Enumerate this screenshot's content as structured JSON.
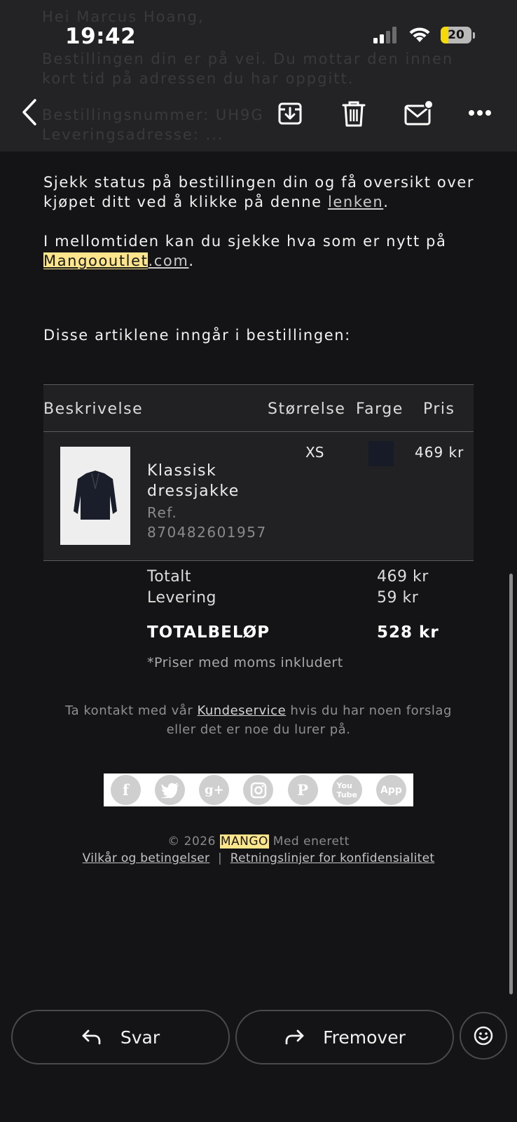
{
  "status_bar": {
    "time": "19:42",
    "battery": "20"
  },
  "ghost_text": [
    "Hei Marcus Hoang,",
    "Bestillingen din er på vei. Du mottar den innen",
    "kort tid på adressen du har oppgitt.",
    "Bestillingsnummer: UH9G",
    "Leveringsadresse: ..."
  ],
  "email": {
    "para1_text": "Sjekk status på bestillingen din og få oversikt over kjøpet ditt ved å klikke på denne ",
    "para1_link": "lenken",
    "para1_end": ".",
    "para2_text": "I mellomtiden kan du sjekke hva som er nytt på ",
    "para2_link_highlight": "Mangooutlet",
    "para2_link_rest": ".com",
    "para2_end": ".",
    "items_intro": "Disse artiklene inngår i bestillingen:",
    "table": {
      "headers": [
        "Beskrivelse",
        "Størrelse",
        "Farge",
        "Pris"
      ],
      "item": {
        "name": "Klassisk dressjakke",
        "ref": "Ref. 870482601957",
        "size": "XS",
        "color": "#161b27",
        "price": "469 kr"
      }
    },
    "summary": {
      "total_label": "Totalt",
      "total_value": "469 kr",
      "delivery_label": "Levering",
      "delivery_value": "59 kr",
      "grand_label": "TOTALBELØP",
      "grand_value": "528 kr",
      "vat_note": "*Priser med moms inkludert"
    },
    "contact_pre": "Ta kontakt med vår ",
    "contact_link": "Kundeservice",
    "contact_post": " hvis du har noen forslag eller det er noe du lurer på.",
    "social_icons": [
      "facebook-icon",
      "twitter-icon",
      "googleplus-icon",
      "instagram-icon",
      "pinterest-icon",
      "youtube-icon",
      "app-icon"
    ],
    "footer_copyright_pre": "© 2026 ",
    "footer_brand": "MANGO",
    "footer_copyright_post": " Med enerett",
    "footer_link1": "Vilkår og betingelser",
    "footer_sep": "|",
    "footer_link2": "Retningslinjer for konfidensialitet"
  },
  "actions": {
    "reply": "Svar",
    "forward": "Fremover"
  }
}
